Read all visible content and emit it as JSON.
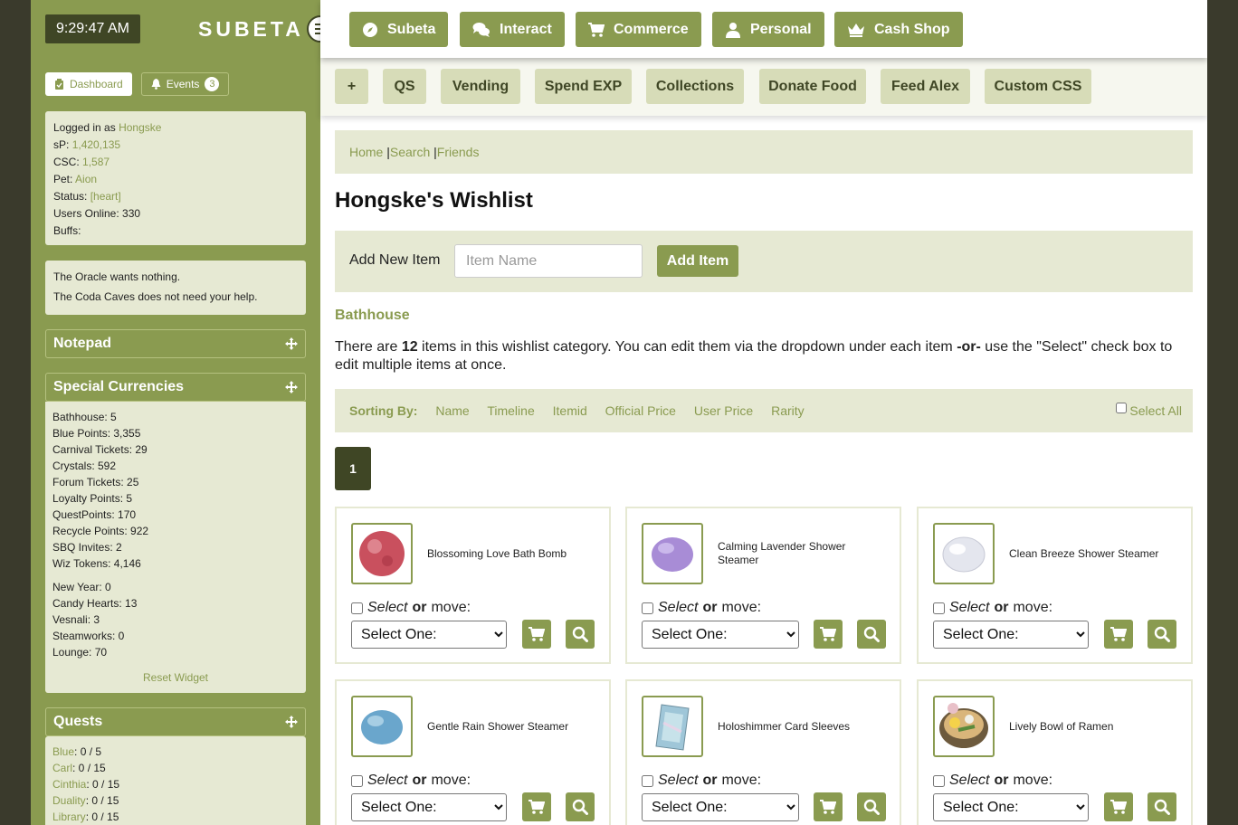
{
  "sidebar": {
    "clock": "9:29:47 AM",
    "logo": "SUBETA",
    "tabs": {
      "dashboard": "Dashboard",
      "events": "Events",
      "events_count": "3"
    },
    "info": {
      "logged_label": "Logged in as",
      "username": "Hongske",
      "sp_label": "sP:",
      "sp": "1,420,135",
      "csc_label": "CSC:",
      "csc": "1,587",
      "pet_label": "Pet:",
      "pet": "Aion",
      "status_label": "Status:",
      "status": "[heart]",
      "online": "Users Online: 330",
      "buffs": "Buffs:"
    },
    "oracle": [
      "The Oracle wants nothing.",
      "The Coda Caves does not need your help."
    ],
    "notepad_title": "Notepad",
    "currencies_title": "Special Currencies",
    "currencies": [
      "Bathhouse: 5",
      "Blue Points: 3,355",
      "Carnival Tickets: 29",
      "Crystals: 592",
      "Forum Tickets: 25",
      "Loyalty Points: 5",
      "QuestPoints: 170",
      "Recycle Points: 922",
      "SBQ Invites: 2",
      "Wiz Tokens: 4,146"
    ],
    "currencies2": [
      "New Year: 0",
      "Candy Hearts: 13",
      "Vesnali: 3",
      "Steamworks: 0",
      "Lounge: 70"
    ],
    "reset": "Reset Widget",
    "quests_title": "Quests",
    "quests": [
      {
        "name": "Blue",
        "count": ": 0 / 5"
      },
      {
        "name": "Carl",
        "count": ": 0 / 15"
      },
      {
        "name": "Cinthia",
        "count": ": 0 / 15"
      },
      {
        "name": "Duality",
        "count": ": 0 / 15"
      },
      {
        "name": "Library",
        "count": ": 0 / 15"
      }
    ]
  },
  "topnav": [
    "Subeta",
    "Interact",
    "Commerce",
    "Personal",
    "Cash Shop"
  ],
  "subnav": [
    "+",
    "QS",
    "Vending",
    "Spend EXP",
    "Collections",
    "Donate Food",
    "Feed Alex",
    "Custom CSS"
  ],
  "breadcrumb": {
    "home": "Home",
    "sep1": "|",
    "search": "Search",
    "sep2": "|",
    "friends": "Friends"
  },
  "title": "Hongske's Wishlist",
  "add": {
    "label": "Add New Item",
    "placeholder": "Item Name",
    "button": "Add Item"
  },
  "category": "Bathhouse",
  "desc": {
    "pre": "There are ",
    "count": "12",
    "mid": " items in this wishlist category. You can edit them via the dropdown under each item ",
    "or": "-or-",
    "post": " use the \"Select\" check box to edit multiple items at once."
  },
  "sort": {
    "label": "Sorting By:",
    "options": [
      "Name",
      "Timeline",
      "Itemid",
      "Official Price",
      "User Price",
      "Rarity"
    ],
    "select_all": "Select All"
  },
  "page": "1",
  "select_text": {
    "select": "Select",
    "or": "or",
    "move": "move:"
  },
  "select_option": "Select One:",
  "items": [
    {
      "name": "Blossoming Love Bath Bomb",
      "color": "#c9505e"
    },
    {
      "name": "Calming Lavender Shower Steamer",
      "color": "#a88cd6"
    },
    {
      "name": "Clean Breeze Shower Steamer",
      "color": "#e4e6ee"
    },
    {
      "name": "Gentle Rain Shower Steamer",
      "color": "#6aa6cc"
    },
    {
      "name": "Holoshimmer Card Sleeves",
      "color": "#9fc6d8"
    },
    {
      "name": "Lively Bowl of Ramen",
      "color": "#6d5a3d"
    }
  ]
}
